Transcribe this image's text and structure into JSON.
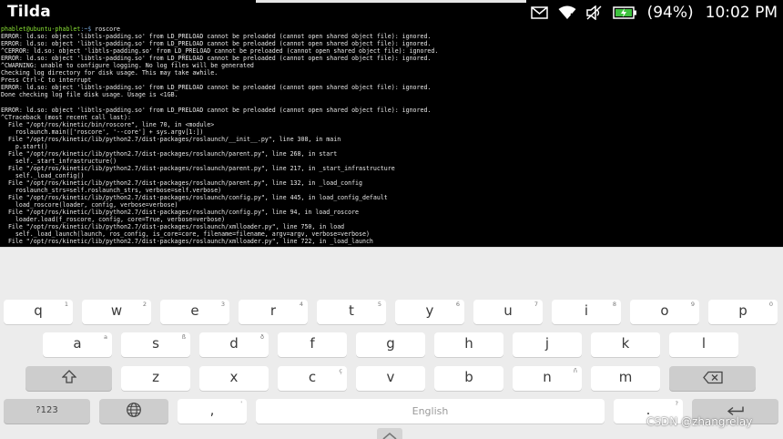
{
  "status_bar": {
    "app_title": "Tilda",
    "battery_percent": "(94%)",
    "time": "10:02 PM",
    "icons": [
      "mail-icon",
      "wifi-icon",
      "volume-muted-icon",
      "battery-icon"
    ]
  },
  "terminal": {
    "prompt_user": "phablet@ubuntu-phablet",
    "prompt_path": ":~$",
    "prompt_command": " roscore",
    "lines": [
      "ERROR: ld.so: object 'libtls-padding.so' from LD_PRELOAD cannot be preloaded (cannot open shared object file): ignored.",
      "ERROR: ld.so: object 'libtls-padding.so' from LD_PRELOAD cannot be preloaded (cannot open shared object file): ignored.",
      "^CERROR: ld.so: object 'libtls-padding.so' from LD_PRELOAD cannot be preloaded (cannot open shared object file): ignored.",
      "ERROR: ld.so: object 'libtls-padding.so' from LD_PRELOAD cannot be preloaded (cannot open shared object file): ignored.",
      "^CWARNING: unable to configure logging. No log files will be generated",
      "Checking log directory for disk usage. This may take awhile.",
      "Press Ctrl-C to interrupt",
      "ERROR: ld.so: object 'libtls-padding.so' from LD_PRELOAD cannot be preloaded (cannot open shared object file): ignored.",
      "Done checking log file disk usage. Usage is <1GB.",
      "",
      "ERROR: ld.so: object 'libtls-padding.so' from LD_PRELOAD cannot be preloaded (cannot open shared object file): ignored.",
      "^CTraceback (most recent call last):",
      "  File \"/opt/ros/kinetic/bin/roscore\", line 70, in <module>",
      "    roslaunch.main(['roscore', '--core'] + sys.argv[1:])",
      "  File \"/opt/ros/kinetic/lib/python2.7/dist-packages/roslaunch/__init__.py\", line 308, in main",
      "    p.start()",
      "  File \"/opt/ros/kinetic/lib/python2.7/dist-packages/roslaunch/parent.py\", line 268, in start",
      "    self._start_infrastructure()",
      "  File \"/opt/ros/kinetic/lib/python2.7/dist-packages/roslaunch/parent.py\", line 217, in _start_infrastructure",
      "    self._load_config()",
      "  File \"/opt/ros/kinetic/lib/python2.7/dist-packages/roslaunch/parent.py\", line 132, in _load_config",
      "    roslaunch_strs=self.roslaunch_strs, verbose=self.verbose)",
      "  File \"/opt/ros/kinetic/lib/python2.7/dist-packages/roslaunch/config.py\", line 445, in load_config_default",
      "    load_roscore(loader, config, verbose=verbose)",
      "  File \"/opt/ros/kinetic/lib/python2.7/dist-packages/roslaunch/config.py\", line 94, in load_roscore",
      "    loader.load(f_roscore, config, core=True, verbose=verbose)",
      "  File \"/opt/ros/kinetic/lib/python2.7/dist-packages/roslaunch/xmlloader.py\", line 750, in load",
      "    self._load_launch(launch, ros_config, is_core=core, filename=filename, argv=argv, verbose=verbose)",
      "  File \"/opt/ros/kinetic/lib/python2.7/dist-packages/roslaunch/xmlloader.py\", line 722, in _load_launch"
    ]
  },
  "keyboard": {
    "row1": [
      {
        "label": "q",
        "sup": "1"
      },
      {
        "label": "w",
        "sup": "2"
      },
      {
        "label": "e",
        "sup": "3"
      },
      {
        "label": "r",
        "sup": "4"
      },
      {
        "label": "t",
        "sup": "5"
      },
      {
        "label": "y",
        "sup": "6"
      },
      {
        "label": "u",
        "sup": "7"
      },
      {
        "label": "i",
        "sup": "8"
      },
      {
        "label": "o",
        "sup": "9"
      },
      {
        "label": "p",
        "sup": "0"
      }
    ],
    "row2": [
      {
        "label": "a",
        "sup": "a"
      },
      {
        "label": "s",
        "sup": "ß"
      },
      {
        "label": "d",
        "sup": "ð"
      },
      {
        "label": "f",
        "sup": ""
      },
      {
        "label": "g",
        "sup": ""
      },
      {
        "label": "h",
        "sup": ""
      },
      {
        "label": "j",
        "sup": ""
      },
      {
        "label": "k",
        "sup": ""
      },
      {
        "label": "l",
        "sup": ""
      }
    ],
    "row3": [
      {
        "label": "z",
        "sup": ""
      },
      {
        "label": "x",
        "sup": ""
      },
      {
        "label": "c",
        "sup": "ç"
      },
      {
        "label": "v",
        "sup": ""
      },
      {
        "label": "b",
        "sup": ""
      },
      {
        "label": "n",
        "sup": "ñ"
      },
      {
        "label": "m",
        "sup": ""
      }
    ],
    "symbols_label": "?123",
    "comma_label": ",",
    "comma_sup": "'",
    "space_label": "English",
    "period_label": ".",
    "period_sup": "?"
  },
  "watermark": "CSDN @zhangrelay"
}
